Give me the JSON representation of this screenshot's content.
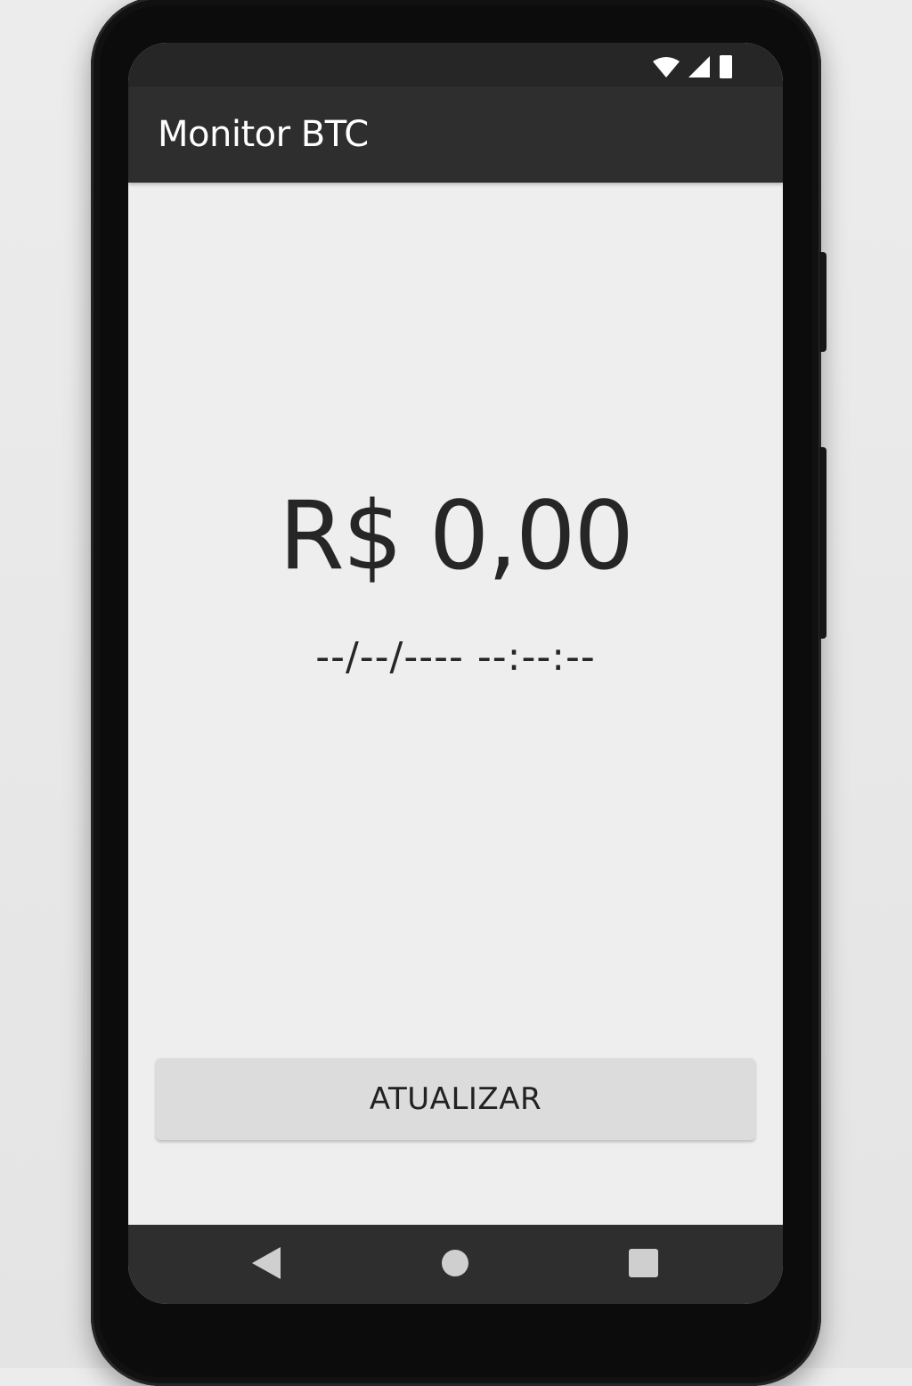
{
  "app": {
    "title": "Monitor BTC"
  },
  "main": {
    "price": "R$ 0,00",
    "timestamp": "--/--/---- --:--:--"
  },
  "actions": {
    "refresh_label": "ATUALIZAR"
  },
  "status_bar": {
    "icons": [
      "wifi-icon",
      "signal-icon",
      "battery-icon"
    ]
  },
  "nav_bar": {
    "icons": [
      "back-icon",
      "home-icon",
      "recents-icon"
    ]
  },
  "colors": {
    "app_bar": "#2e2e2e",
    "status_bar": "#262626",
    "background": "#eeeeee",
    "button": "#dcdcdc",
    "text": "#262626"
  }
}
